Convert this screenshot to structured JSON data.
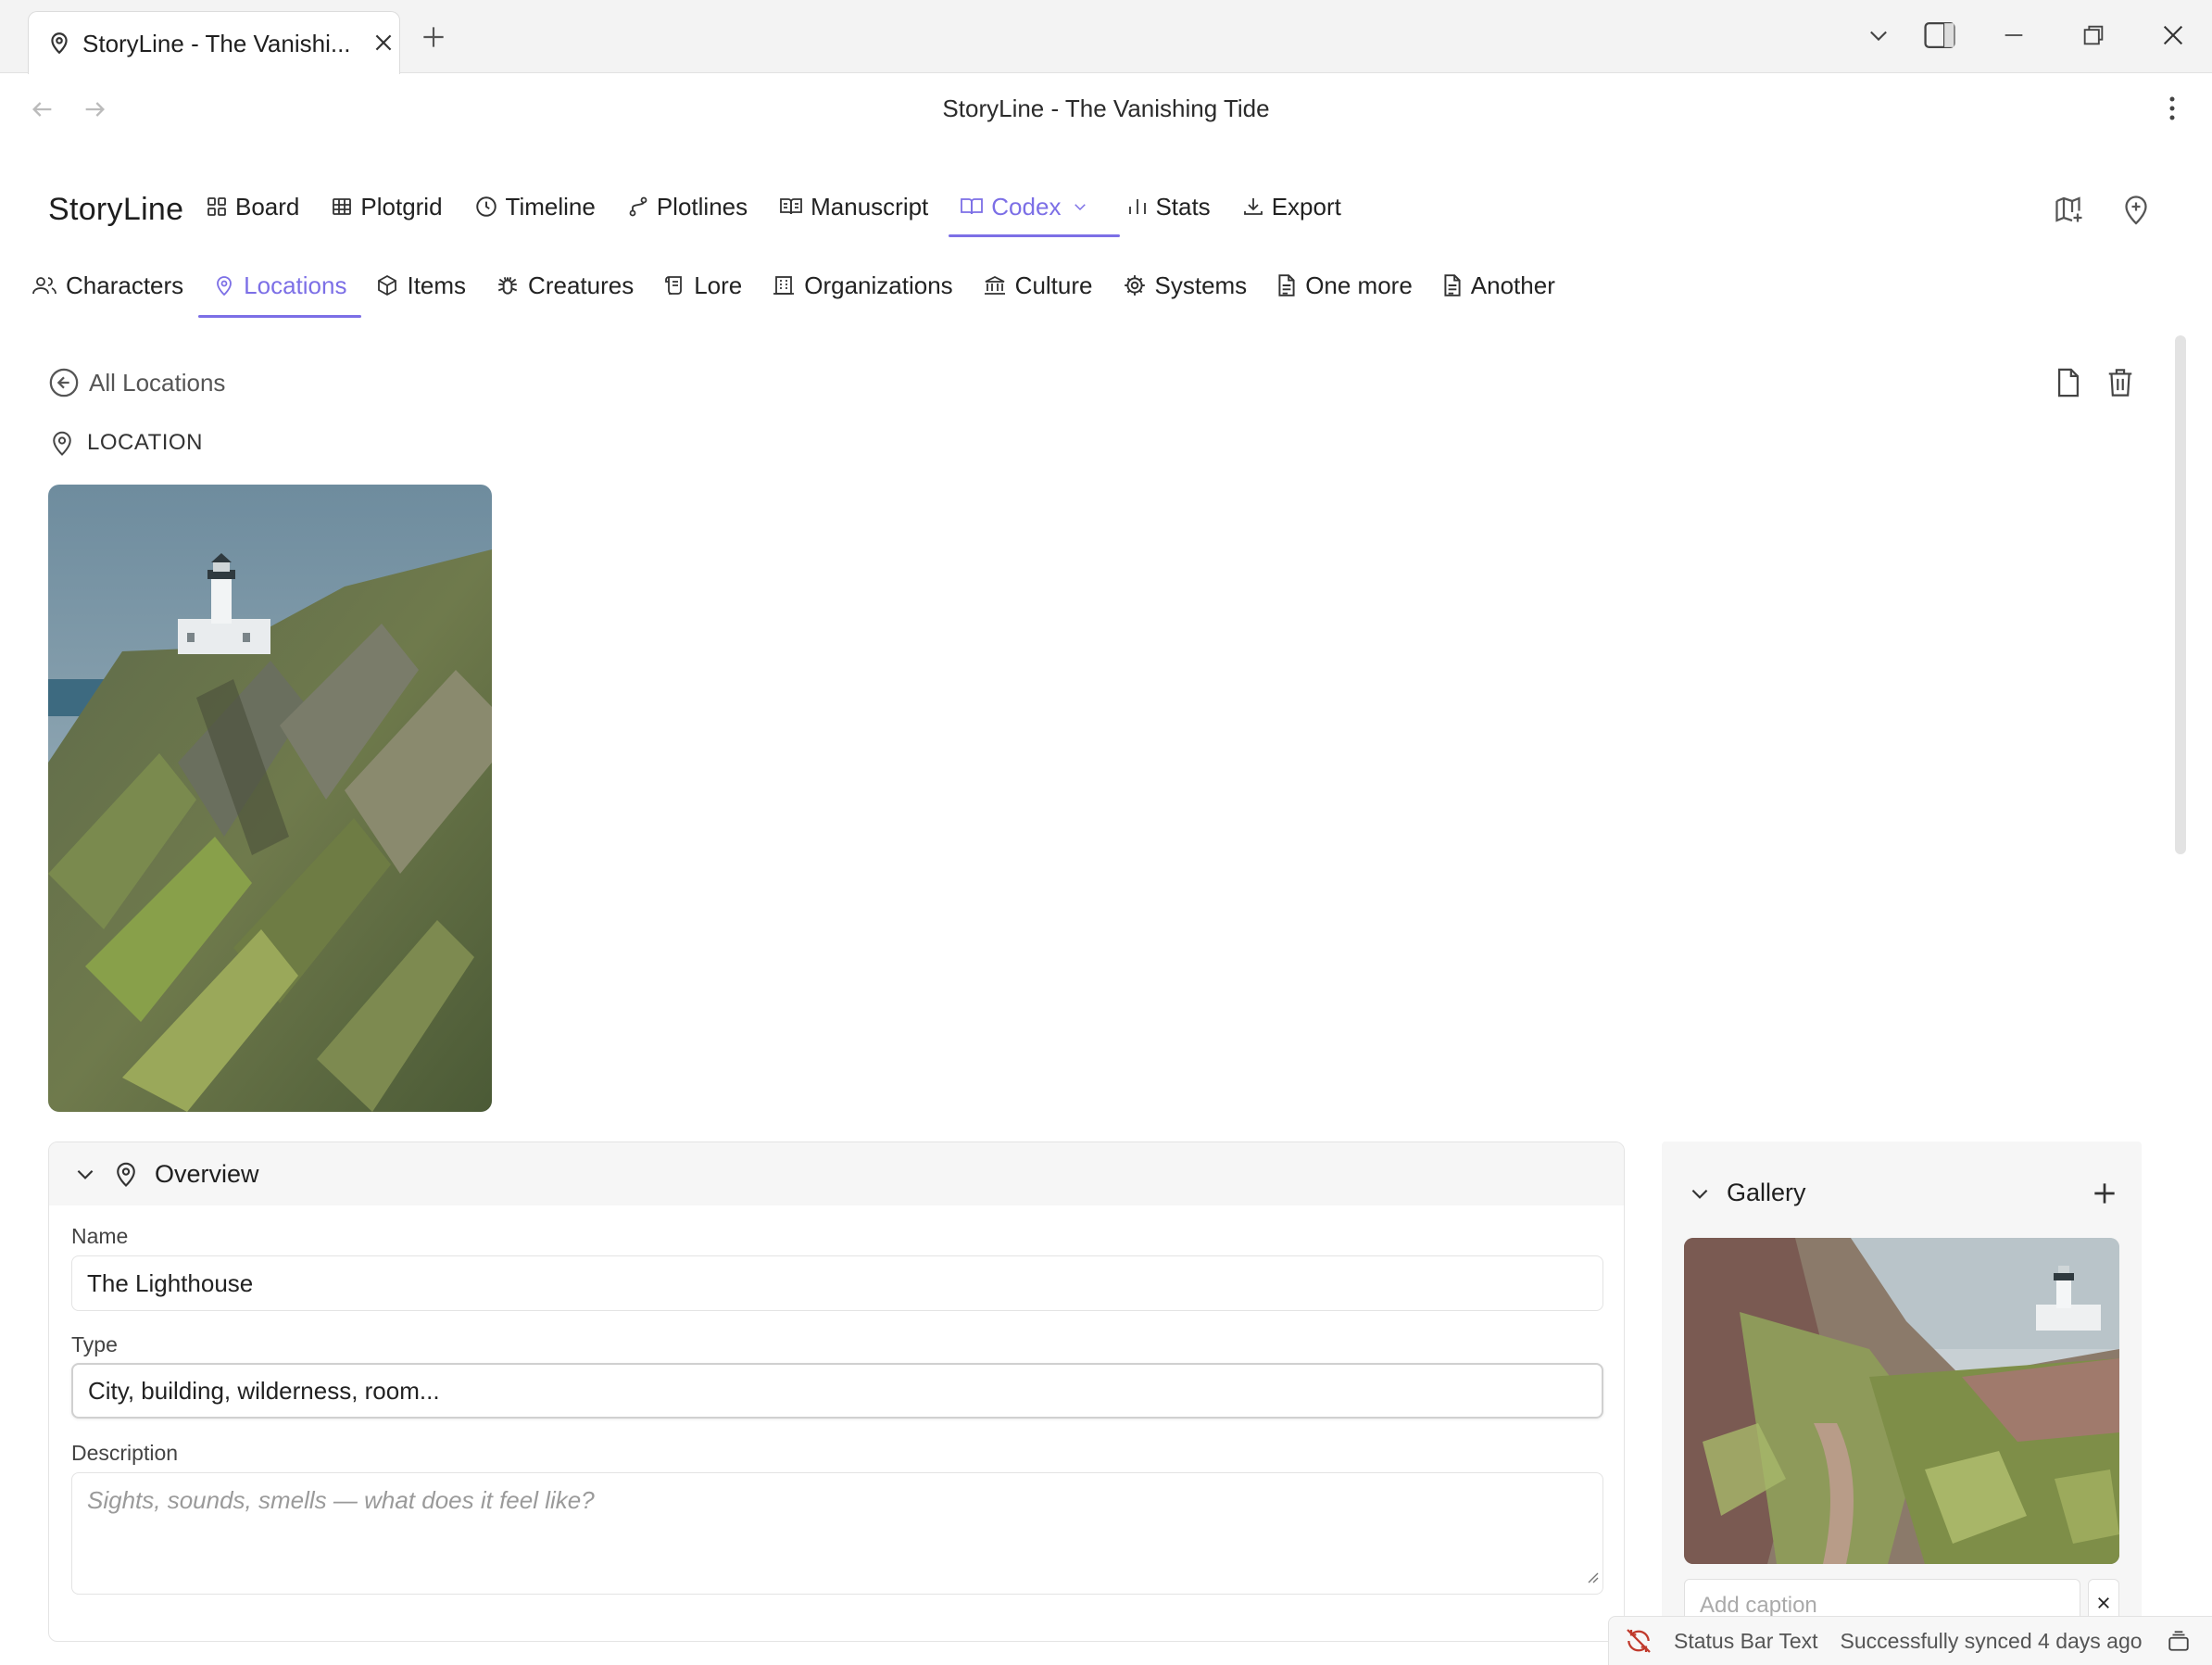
{
  "browser": {
    "tab_title": "StoryLine - The Vanishi...",
    "page_title": "StoryLine - The Vanishing Tide"
  },
  "app": {
    "brand": "StoryLine",
    "accent_color": "#7c6fe6"
  },
  "main_nav": [
    {
      "label": "Board",
      "icon": "board-icon"
    },
    {
      "label": "Plotgrid",
      "icon": "grid-icon"
    },
    {
      "label": "Timeline",
      "icon": "clock-icon"
    },
    {
      "label": "Plotlines",
      "icon": "branch-icon"
    },
    {
      "label": "Manuscript",
      "icon": "book-open-icon"
    },
    {
      "label": "Codex",
      "icon": "book-icon",
      "active": true
    },
    {
      "label": "Stats",
      "icon": "bar-chart-icon"
    },
    {
      "label": "Export",
      "icon": "download-icon"
    }
  ],
  "codex_nav": [
    {
      "label": "Characters",
      "icon": "users-icon"
    },
    {
      "label": "Locations",
      "icon": "map-pin-icon",
      "active": true
    },
    {
      "label": "Items",
      "icon": "box-icon"
    },
    {
      "label": "Creatures",
      "icon": "bug-icon"
    },
    {
      "label": "Lore",
      "icon": "scroll-icon"
    },
    {
      "label": "Organizations",
      "icon": "building-icon"
    },
    {
      "label": "Culture",
      "icon": "landmark-icon"
    },
    {
      "label": "Systems",
      "icon": "cog-icon"
    },
    {
      "label": "One more",
      "icon": "file-text-icon"
    },
    {
      "label": "Another",
      "icon": "file-text-icon"
    }
  ],
  "content": {
    "back_label": "All Locations",
    "kind_label": "LOCATION"
  },
  "overview": {
    "title": "Overview",
    "name_label": "Name",
    "name_value": "The Lighthouse",
    "type_label": "Type",
    "type_value": "City, building, wilderness, room...",
    "description_label": "Description",
    "description_placeholder": "Sights, sounds, smells — what does it feel like?"
  },
  "gallery": {
    "title": "Gallery",
    "caption_placeholder": "Add caption"
  },
  "status": {
    "text": "Status Bar Text",
    "sync": "Successfully synced 4 days ago"
  }
}
